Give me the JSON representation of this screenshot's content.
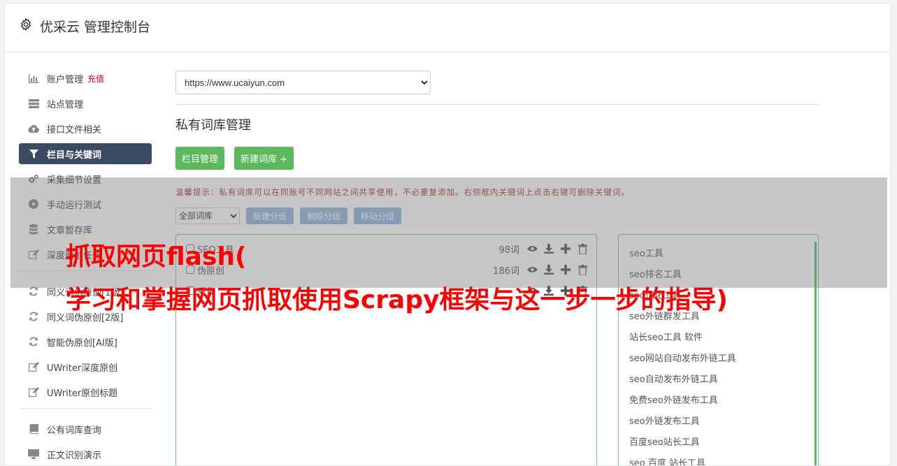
{
  "header": {
    "title": "优采云 管理控制台",
    "icon": "gear-icon"
  },
  "sidebar": {
    "group1": [
      {
        "label": "账户管理",
        "badge": "充值",
        "icon": "bar-chart-icon"
      },
      {
        "label": "站点管理",
        "icon": "server-icon"
      },
      {
        "label": "接口文件相关",
        "icon": "cloud-upload-icon"
      },
      {
        "label": "栏目与关键词",
        "icon": "filter-icon",
        "active": true
      },
      {
        "label": "采集细节设置",
        "icon": "cogs-icon"
      },
      {
        "label": "手动运行测试",
        "icon": "play-circle-icon"
      },
      {
        "label": "文章暂存库",
        "icon": "database-icon"
      },
      {
        "label": "深度原创任务",
        "icon": "edit-icon"
      }
    ],
    "group2": [
      {
        "label": "同义词伪原创[1版]",
        "icon": "refresh-icon"
      },
      {
        "label": "同义词伪原创[2版]",
        "icon": "refresh-icon"
      },
      {
        "label": "智能伪原创[AI版]",
        "icon": "refresh-icon"
      },
      {
        "label": "UWriter深度原创",
        "icon": "edit-icon"
      },
      {
        "label": "UWriter原创标题",
        "icon": "edit-icon"
      }
    ],
    "group3": [
      {
        "label": "公有词库查询",
        "icon": "book-icon"
      },
      {
        "label": "正文识别演示",
        "icon": "monitor-icon"
      }
    ]
  },
  "main": {
    "site_select": "https://www.ucaiyun.com",
    "section_title": "私有词库管理",
    "btn_column_manage": "栏目管理",
    "btn_new_lexicon": "新建词库 +",
    "tip": "温馨提示：私有词库可以在同账号不同网站之间共享使用，不必重复添加。右侧框内关键词上点击右键可删除关键词。",
    "filter_select": "全部词库",
    "btn_new_group": "新建分组",
    "btn_delete_group": "删除分组",
    "btn_move_group": "移动分组",
    "groups": [
      {
        "name": "SEO工具",
        "count": "98词"
      },
      {
        "name": "伪原创",
        "count": "186词"
      },
      {
        "name": "采集",
        "count": ""
      }
    ],
    "keywords": [
      "seo工具",
      "seo排名工具",
      "seo优化工具",
      "seo外链群发工具",
      "站长seo工具 软件",
      "seo网站自动发布外链工具",
      "seo自动发布外链工具",
      "免费seo外链发布工具",
      "seo外链发布工具",
      "百度seo站长工具",
      "seo 百度 站长工具"
    ]
  },
  "overlay": {
    "line1": "抓取网页flash(",
    "line2": "学习和掌握网页抓取使用Scrapy框架与这一步一步的指导)"
  }
}
